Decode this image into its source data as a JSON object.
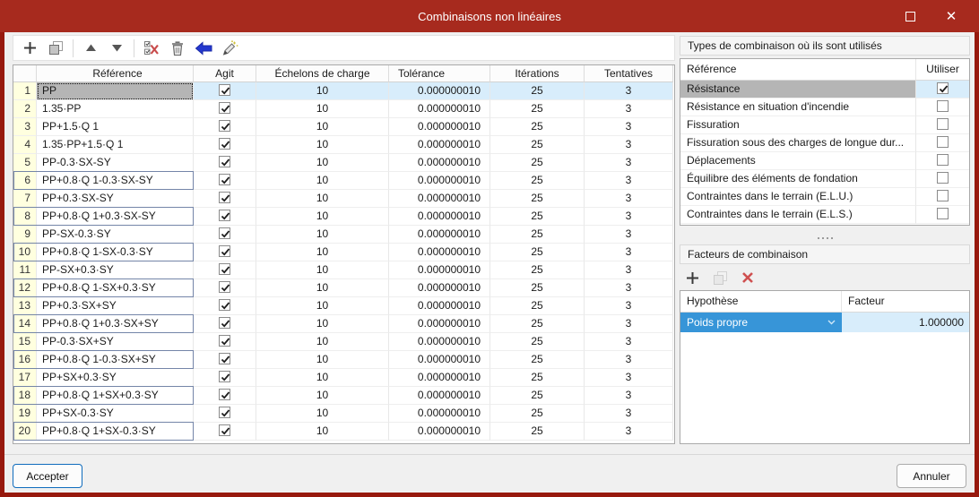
{
  "window": {
    "title": "Combinaisons non linéaires"
  },
  "window_controls": {
    "maximize": "maximize",
    "close": "close"
  },
  "main_toolbar": {
    "items": [
      "add",
      "copy",
      "separator",
      "move-up",
      "move-down",
      "separator",
      "delete-checked",
      "delete",
      "assign",
      "modify"
    ]
  },
  "main_table": {
    "columns": [
      "",
      "Référence",
      "Agit",
      "Échelons de charge",
      "Tolérance",
      "Itérations",
      "Tentatives"
    ],
    "rows": [
      {
        "num": 1,
        "reference": "PP",
        "agit": true,
        "echelons": "10",
        "tolerance": "0.000000010",
        "iterations": "25",
        "tentatives": "3",
        "selected": true,
        "boxed": false
      },
      {
        "num": 2,
        "reference": "1.35·PP",
        "agit": true,
        "echelons": "10",
        "tolerance": "0.000000010",
        "iterations": "25",
        "tentatives": "3",
        "selected": false,
        "boxed": false
      },
      {
        "num": 3,
        "reference": "PP+1.5·Q 1",
        "agit": true,
        "echelons": "10",
        "tolerance": "0.000000010",
        "iterations": "25",
        "tentatives": "3",
        "selected": false,
        "boxed": false
      },
      {
        "num": 4,
        "reference": "1.35·PP+1.5·Q 1",
        "agit": true,
        "echelons": "10",
        "tolerance": "0.000000010",
        "iterations": "25",
        "tentatives": "3",
        "selected": false,
        "boxed": false
      },
      {
        "num": 5,
        "reference": "PP-0.3·SX-SY",
        "agit": true,
        "echelons": "10",
        "tolerance": "0.000000010",
        "iterations": "25",
        "tentatives": "3",
        "selected": false,
        "boxed": false
      },
      {
        "num": 6,
        "reference": "PP+0.8·Q 1-0.3·SX-SY",
        "agit": true,
        "echelons": "10",
        "tolerance": "0.000000010",
        "iterations": "25",
        "tentatives": "3",
        "selected": false,
        "boxed": true
      },
      {
        "num": 7,
        "reference": "PP+0.3·SX-SY",
        "agit": true,
        "echelons": "10",
        "tolerance": "0.000000010",
        "iterations": "25",
        "tentatives": "3",
        "selected": false,
        "boxed": false
      },
      {
        "num": 8,
        "reference": "PP+0.8·Q 1+0.3·SX-SY",
        "agit": true,
        "echelons": "10",
        "tolerance": "0.000000010",
        "iterations": "25",
        "tentatives": "3",
        "selected": false,
        "boxed": true
      },
      {
        "num": 9,
        "reference": "PP-SX-0.3·SY",
        "agit": true,
        "echelons": "10",
        "tolerance": "0.000000010",
        "iterations": "25",
        "tentatives": "3",
        "selected": false,
        "boxed": false
      },
      {
        "num": 10,
        "reference": "PP+0.8·Q 1-SX-0.3·SY",
        "agit": true,
        "echelons": "10",
        "tolerance": "0.000000010",
        "iterations": "25",
        "tentatives": "3",
        "selected": false,
        "boxed": true
      },
      {
        "num": 11,
        "reference": "PP-SX+0.3·SY",
        "agit": true,
        "echelons": "10",
        "tolerance": "0.000000010",
        "iterations": "25",
        "tentatives": "3",
        "selected": false,
        "boxed": false
      },
      {
        "num": 12,
        "reference": "PP+0.8·Q 1-SX+0.3·SY",
        "agit": true,
        "echelons": "10",
        "tolerance": "0.000000010",
        "iterations": "25",
        "tentatives": "3",
        "selected": false,
        "boxed": true
      },
      {
        "num": 13,
        "reference": "PP+0.3·SX+SY",
        "agit": true,
        "echelons": "10",
        "tolerance": "0.000000010",
        "iterations": "25",
        "tentatives": "3",
        "selected": false,
        "boxed": false
      },
      {
        "num": 14,
        "reference": "PP+0.8·Q 1+0.3·SX+SY",
        "agit": true,
        "echelons": "10",
        "tolerance": "0.000000010",
        "iterations": "25",
        "tentatives": "3",
        "selected": false,
        "boxed": true
      },
      {
        "num": 15,
        "reference": "PP-0.3·SX+SY",
        "agit": true,
        "echelons": "10",
        "tolerance": "0.000000010",
        "iterations": "25",
        "tentatives": "3",
        "selected": false,
        "boxed": false
      },
      {
        "num": 16,
        "reference": "PP+0.8·Q 1-0.3·SX+SY",
        "agit": true,
        "echelons": "10",
        "tolerance": "0.000000010",
        "iterations": "25",
        "tentatives": "3",
        "selected": false,
        "boxed": true
      },
      {
        "num": 17,
        "reference": "PP+SX+0.3·SY",
        "agit": true,
        "echelons": "10",
        "tolerance": "0.000000010",
        "iterations": "25",
        "tentatives": "3",
        "selected": false,
        "boxed": false
      },
      {
        "num": 18,
        "reference": "PP+0.8·Q 1+SX+0.3·SY",
        "agit": true,
        "echelons": "10",
        "tolerance": "0.000000010",
        "iterations": "25",
        "tentatives": "3",
        "selected": false,
        "boxed": true
      },
      {
        "num": 19,
        "reference": "PP+SX-0.3·SY",
        "agit": true,
        "echelons": "10",
        "tolerance": "0.000000010",
        "iterations": "25",
        "tentatives": "3",
        "selected": false,
        "boxed": false
      },
      {
        "num": 20,
        "reference": "PP+0.8·Q 1+SX-0.3·SY",
        "agit": true,
        "echelons": "10",
        "tolerance": "0.000000010",
        "iterations": "25",
        "tentatives": "3",
        "selected": false,
        "boxed": true
      }
    ]
  },
  "types_panel": {
    "title": "Types de combinaison où ils sont utilisés",
    "columns": [
      "Référence",
      "Utiliser"
    ],
    "rows": [
      {
        "label": "Résistance",
        "checked": true,
        "selected": true
      },
      {
        "label": "Résistance en situation d'incendie",
        "checked": false,
        "selected": false
      },
      {
        "label": "Fissuration",
        "checked": false,
        "selected": false
      },
      {
        "label": "Fissuration sous des charges de longue dur...",
        "checked": false,
        "selected": false
      },
      {
        "label": "Déplacements",
        "checked": false,
        "selected": false
      },
      {
        "label": "Équilibre des éléments de fondation",
        "checked": false,
        "selected": false
      },
      {
        "label": "Contraintes dans le terrain (E.L.U.)",
        "checked": false,
        "selected": false
      },
      {
        "label": "Contraintes dans le terrain (E.L.S.)",
        "checked": false,
        "selected": false
      }
    ]
  },
  "factors_panel": {
    "title": "Facteurs de combinaison",
    "toolbar": {
      "items": [
        "add",
        "copy-disabled",
        "delete-x"
      ]
    },
    "columns": [
      "Hypothèse",
      "Facteur"
    ],
    "rows": [
      {
        "hypothese": "Poids propre",
        "facteur": "1.000000",
        "selected": true
      }
    ]
  },
  "footer": {
    "accept_label": "Accepter",
    "cancel_label": "Annuler"
  },
  "colors": {
    "titlebar_red": "#a72a1e",
    "frame_red": "#97190e",
    "selection_blue": "#d8edfb",
    "selected_cell_gray": "#b5b5b5",
    "row_number_yellow": "#ffffdf",
    "dropdown_blue": "#3795d8",
    "default_button_blue": "#0f6cbd",
    "assign_arrow_blue": "#2438cf",
    "delete_red": "#cf5050",
    "group_outline": "#7485a8"
  }
}
